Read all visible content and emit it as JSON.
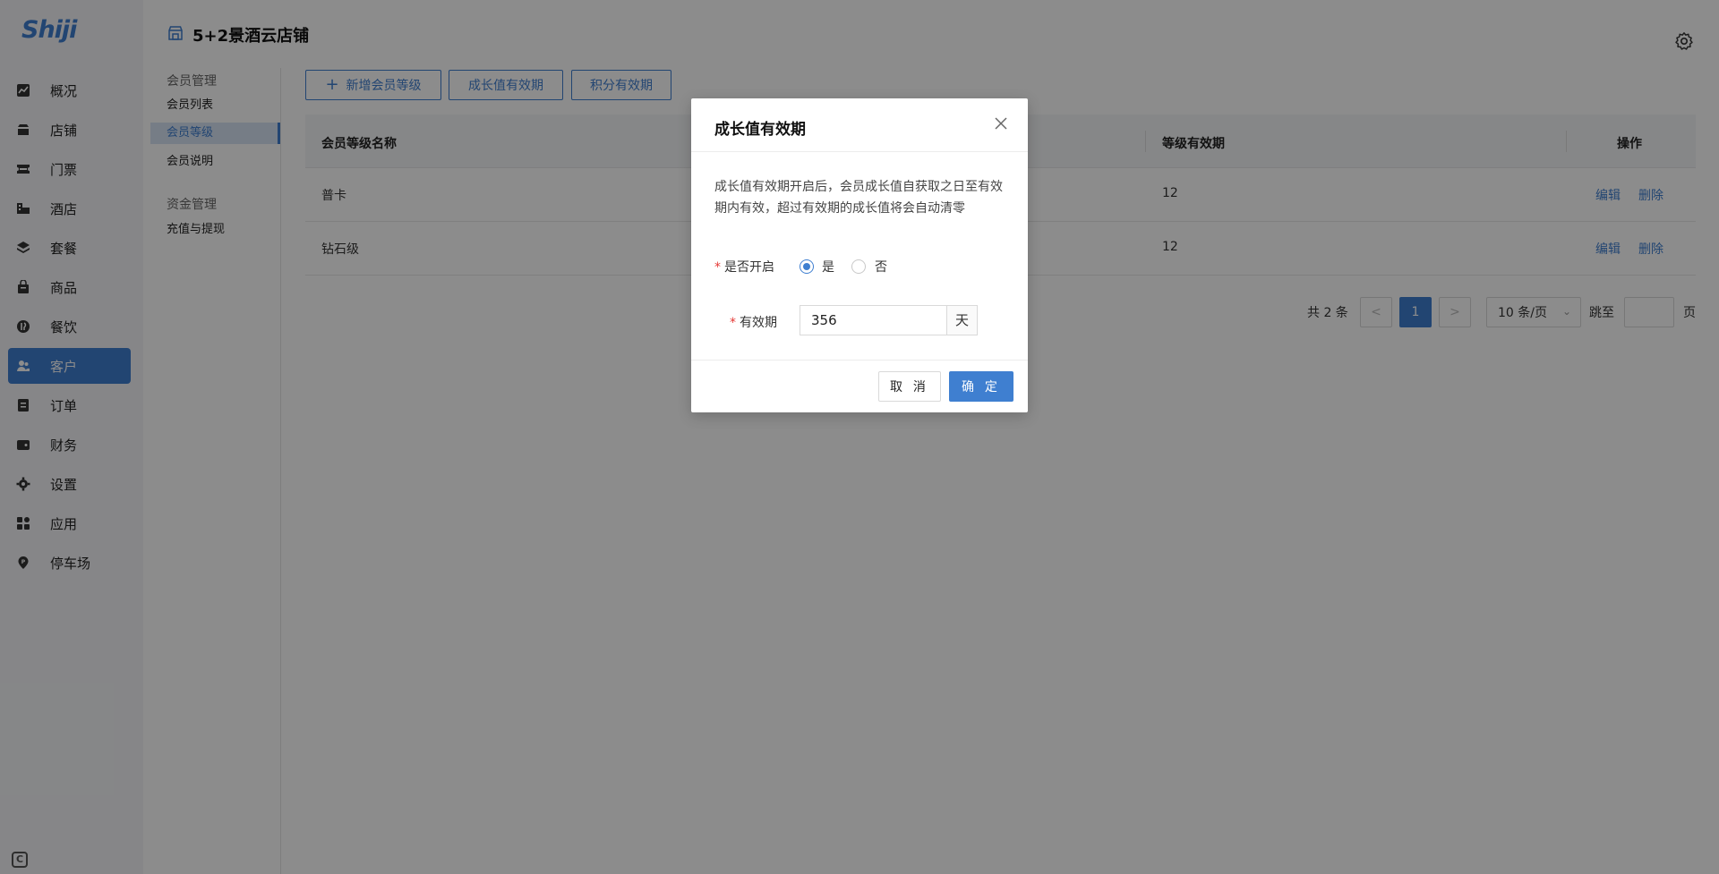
{
  "logo": "Shiji",
  "sidebar": {
    "items": [
      {
        "label": "概况",
        "icon": "chart-icon"
      },
      {
        "label": "店铺",
        "icon": "store-icon"
      },
      {
        "label": "门票",
        "icon": "ticket-icon"
      },
      {
        "label": "酒店",
        "icon": "hotel-icon"
      },
      {
        "label": "套餐",
        "icon": "layers-icon"
      },
      {
        "label": "商品",
        "icon": "bag-icon"
      },
      {
        "label": "餐饮",
        "icon": "dining-icon"
      },
      {
        "label": "客户",
        "icon": "users-icon",
        "active": true
      },
      {
        "label": "订单",
        "icon": "order-icon"
      },
      {
        "label": "财务",
        "icon": "wallet-icon"
      },
      {
        "label": "设置",
        "icon": "gear-icon"
      },
      {
        "label": "应用",
        "icon": "apps-icon"
      },
      {
        "label": "停车场",
        "icon": "parking-icon"
      }
    ]
  },
  "header": {
    "store_title": "5+2景酒云店铺"
  },
  "submenu": {
    "group1": "会员管理",
    "items1": [
      "会员列表",
      "会员等级",
      "会员说明"
    ],
    "group2": "资金管理",
    "items2": [
      "充值与提现"
    ]
  },
  "toolbar": {
    "add_label": "新增会员等级",
    "growth_label": "成长值有效期",
    "points_label": "积分有效期"
  },
  "table": {
    "columns": [
      "会员等级名称",
      "等级有效期",
      "操作"
    ],
    "rows": [
      {
        "name": "普卡",
        "validity": "12",
        "edit": "编辑",
        "delete": "删除"
      },
      {
        "name": "钻石级",
        "validity": "12",
        "edit": "编辑",
        "delete": "删除"
      }
    ]
  },
  "pagination": {
    "total": "共 2 条",
    "current": "1",
    "page_size": "10 条/页",
    "jump": "跳至",
    "page": "页"
  },
  "modal": {
    "title": "成长值有效期",
    "description": "成长值有效期开启后，会员成长值自获取之日至有效期内有效，超过有效期的成长值将会自动清零",
    "enable_label": "是否开启",
    "yes": "是",
    "no": "否",
    "enabled": true,
    "validity_label": "有效期",
    "validity_value": "356",
    "unit": "天",
    "cancel": "取 消",
    "ok": "确 定"
  },
  "colors": {
    "accent": "#3f7fd0",
    "sidebar_bg": "#f4f5f7",
    "required": "#e53935"
  }
}
